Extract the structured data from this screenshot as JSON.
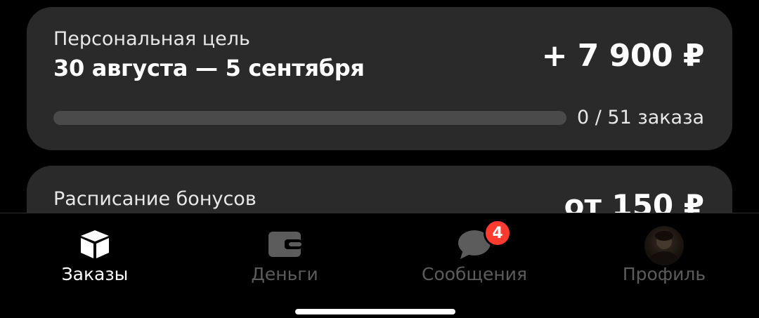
{
  "goal_card": {
    "label": "Персональная цель",
    "dates": "30 августа — 5 сентября",
    "amount": "+ 7 900 ₽",
    "progress_text": "0 / 51 заказа",
    "progress_fraction": 0
  },
  "bonus_card": {
    "label": "Расписание бонусов",
    "amount": "от 150 ₽"
  },
  "tabs": [
    {
      "label": "Заказы",
      "icon": "box-icon",
      "active": true
    },
    {
      "label": "Деньги",
      "icon": "wallet-icon",
      "active": false
    },
    {
      "label": "Сообщения",
      "icon": "chat-bubble-icon",
      "active": false,
      "badge": "4"
    },
    {
      "label": "Профиль",
      "icon": "avatar",
      "active": false
    }
  ],
  "colors": {
    "background": "#000000",
    "card": "#2a2a2a",
    "badge": "#ff3b30",
    "inactive": "#5c5c5c"
  }
}
